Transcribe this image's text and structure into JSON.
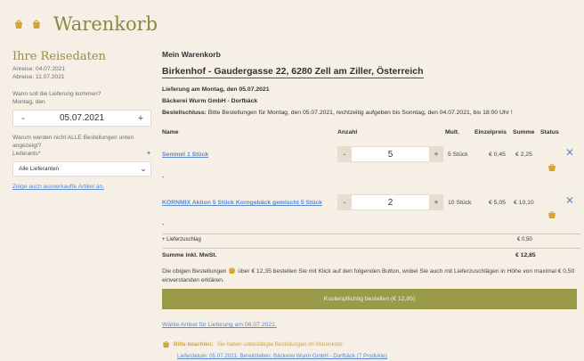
{
  "header": {
    "title": "Warenkorb",
    "icons": [
      "basket-icon",
      "basket-icon"
    ]
  },
  "sidebar": {
    "title": "Ihre Reisedaten",
    "arrival": "Anreise: 04.07.2021",
    "departure": "Abreise: 11.07.2021",
    "delivery_question": "Wann soll die Lieferung kommen?",
    "delivery_day": "Montag, den",
    "date_value": "05.07.2021",
    "minus": "-",
    "plus": "+",
    "unavailable_question": "Warum werden nicht ALLE Bestellungen unten angezeigt?",
    "supplier_label": "Lieferants*",
    "supplier_value": "Alle Lieferanten",
    "sold_out_link": "Zeige auch ausverkaufte Artikel an."
  },
  "main": {
    "title": "Mein Warenkorb",
    "address": "Birkenhof - Gaudergasse 22, 6280 Zell am Ziller, Österreich",
    "delivery_date": "Lieferung am Montag, den 05.07.2021",
    "bakery": "Bäckerei Wurm GmbH - Dorfbäck",
    "deadline_label": "Bestellschluss:",
    "deadline_text": "Bitte Bestellungen für Montag, den 05.07.2021, rechtzeitig aufgeben bis Sonntag, den 04.07.2021, bis 18:00 Uhr !"
  },
  "table": {
    "headers": [
      "Name",
      "Anzahl",
      "Mult.",
      "Einzelpreis",
      "Summe",
      "Status"
    ],
    "rows": [
      {
        "name": "Semmel 1 Stück",
        "qty": "5",
        "mult": "5 Stück",
        "unit_price": "€ 0,45",
        "sum": "€ 2,25",
        "sub": "-"
      },
      {
        "name": "KORNMIX Aktion 5 Stück Korngebäck gemischt 5 Stück",
        "qty": "2",
        "mult": "10 Stück",
        "unit_price": "€ 5,05",
        "sum": "€ 10,10",
        "sub": "-"
      }
    ],
    "surcharge_label": "+ Lieferzuschlag",
    "surcharge_value": "€ 0,50",
    "total_label": "Summe inkl. MwSt.",
    "total_value": "€ 12,85"
  },
  "note": {
    "before": "Die obigen Bestellungen",
    "after": "über € 12,35 bestellen Sie mit Klick auf den folgenden Button, wobei Sie auch mit Lieferzuschlägen in Höhe von maximal € 0,50 einverstanden erklären."
  },
  "order_button": "Kostenpflichtig bestellen (€ 12,85)",
  "alt_link": "Wähle Artikel für Lieferung am 06.07.2021.",
  "warning": {
    "label": "Bitte beachten:",
    "text": "Sie haben unbestätigte Bestellungen im Warenkorb:",
    "link": "Lieferdatum: 05.07.2021, Bereitstellen: Bäckerei Wurm GmbH - Dorfbäck (7 Produkte)"
  },
  "colors": {
    "accent": "#9a9a4a",
    "link": "#5a8bd1",
    "title": "#8b8a3c",
    "warning": "#d4a437",
    "background": "#f5efe6"
  }
}
